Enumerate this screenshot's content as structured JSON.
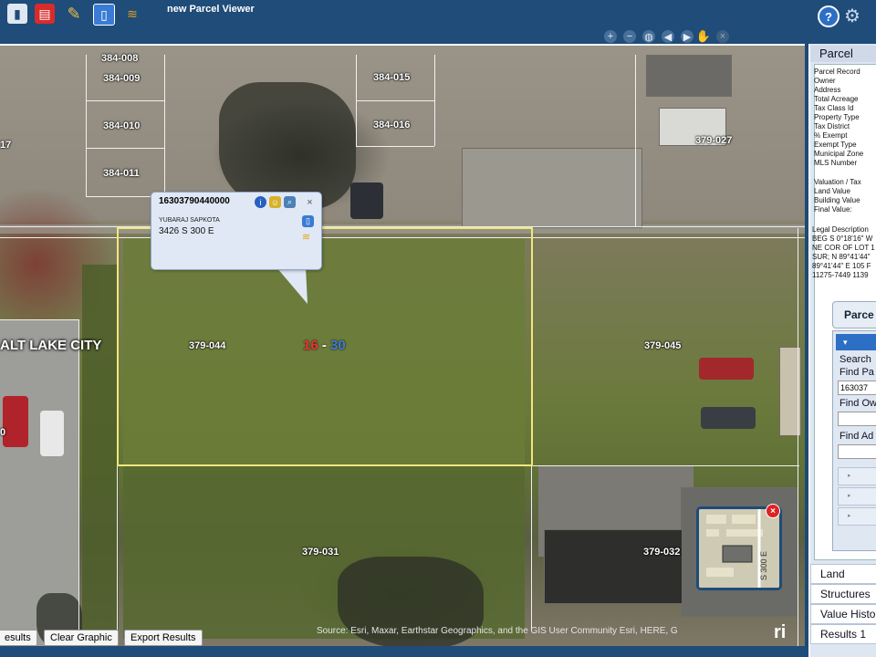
{
  "header": {
    "title": "new Parcel Viewer",
    "help_label": "?"
  },
  "map": {
    "parcel_labels": [
      {
        "id": "p1",
        "text": "384-008"
      },
      {
        "id": "p2",
        "text": "384-009"
      },
      {
        "id": "p3",
        "text": "384-010"
      },
      {
        "id": "p4",
        "text": "384-011"
      },
      {
        "id": "p5",
        "text": "384-015"
      },
      {
        "id": "p6",
        "text": "384-016"
      },
      {
        "id": "p7",
        "text": "379-027"
      },
      {
        "id": "p8",
        "text": "379-044"
      },
      {
        "id": "p9",
        "text": "379-045"
      },
      {
        "id": "p10",
        "text": "379-031"
      },
      {
        "id": "p11",
        "text": "379-032"
      },
      {
        "id": "p12",
        "text": "17"
      },
      {
        "id": "p13",
        "text": "0"
      }
    ],
    "city_label": "ALT LAKE CITY",
    "address_number_red": "16",
    "address_sep": " - ",
    "address_number_blue": "30",
    "attribution": "Source: Esri, Maxar, Earthstar Geographics, and the GIS User Community  Esri, HERE, G",
    "esri_logo": "ri",
    "overview_street": "S 300 E"
  },
  "popup": {
    "parcel_id": "16303790440000",
    "owner": "YUBARAJ SAPKOTA",
    "address": "3426 S 300 E",
    "close": "×"
  },
  "bottom_buttons": {
    "results": "esults",
    "clear_graphic": "Clear Graphic",
    "export_results": "Export Results"
  },
  "sidebar": {
    "title": "Parcel",
    "record_fields": [
      "Parcel Record",
      "Owner",
      "Address",
      "Total Acreage",
      "Tax Class Id",
      "Property Type",
      "Tax District",
      "% Exempt",
      "Exempt Type",
      "Municipal Zone",
      "MLS Number"
    ],
    "valuation_fields": [
      "Valuation / Tax",
      "Land Value",
      "Building Value",
      "Final Value:"
    ],
    "legal_lines": [
      "Legal Description",
      "BEG S 0°18'16\" W",
      "NE COR OF LOT 1",
      "SUR; N 89°41'44\"",
      "89°41'44\" E 105 F",
      "11275-7449 1139"
    ],
    "parcel_button": "Parce",
    "search_header": "Search",
    "find_parcel_label": "Find Pa",
    "find_parcel_value": "163037",
    "find_owner_label": "Find Ow",
    "find_address_label": "Find Ad",
    "tabs": [
      "Land",
      "Structures",
      "Value Histo",
      "Results 1"
    ]
  }
}
